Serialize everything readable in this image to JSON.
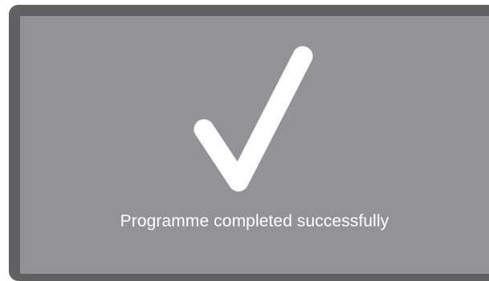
{
  "status": {
    "icon": "checkmark-icon",
    "message": "Programme completed successfully"
  },
  "colors": {
    "frame": "#606163",
    "screen": "#929396",
    "foreground": "#ffffff"
  }
}
